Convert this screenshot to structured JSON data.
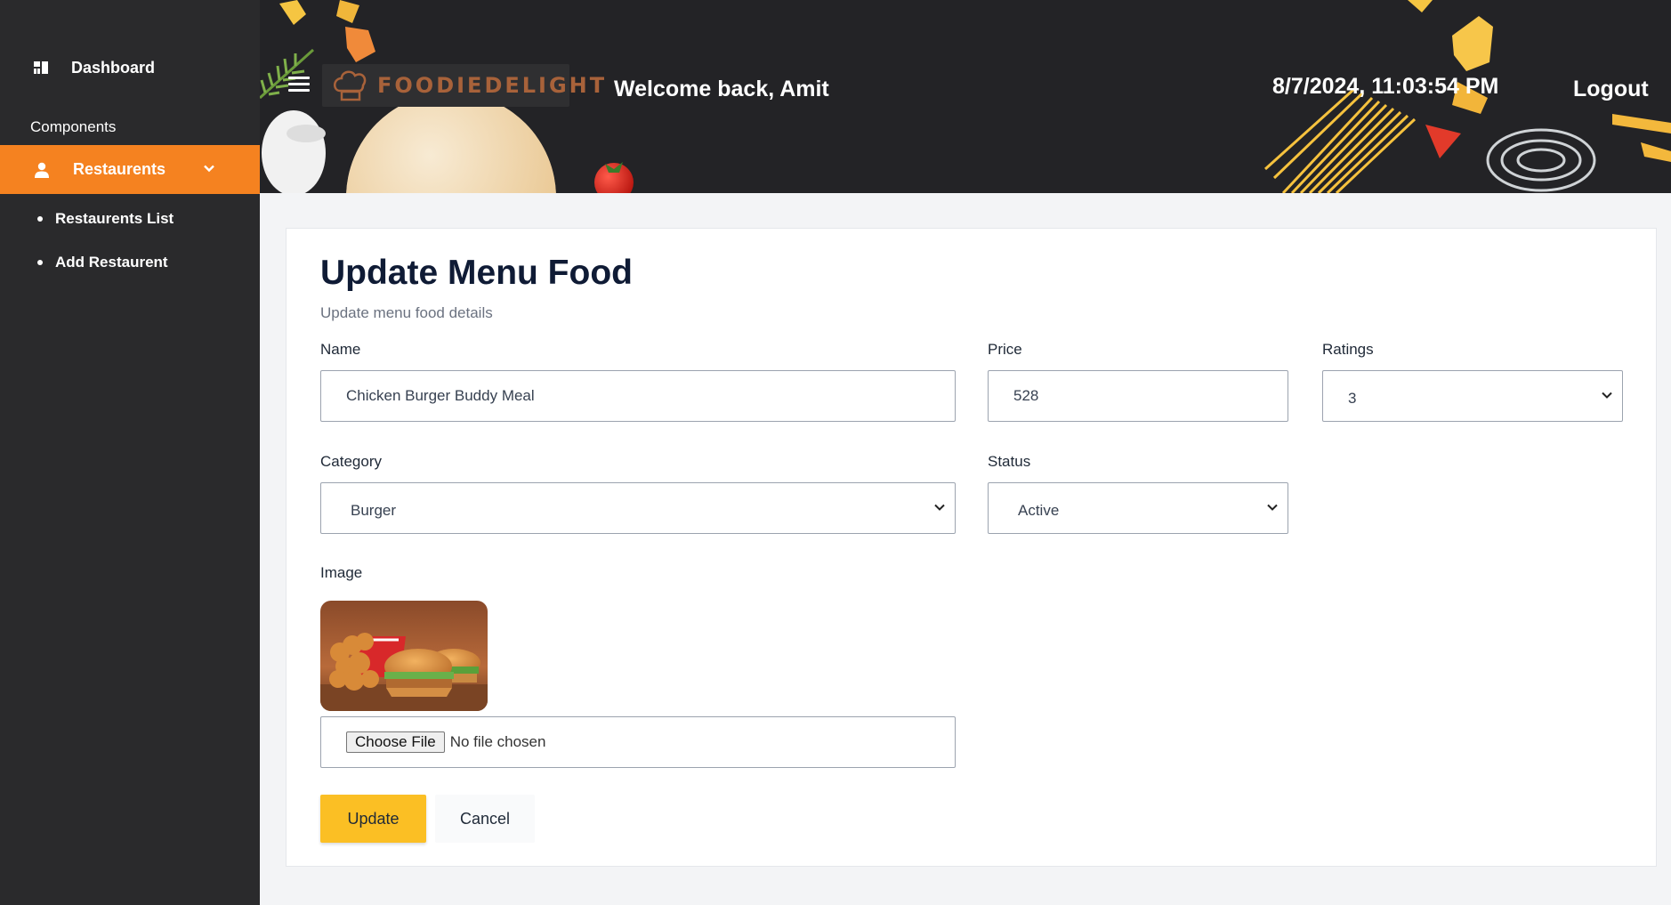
{
  "sidebar": {
    "dashboard_label": "Dashboard",
    "section_label": "Components",
    "restaurants_label": "Restaurents",
    "sub_items": [
      {
        "label": "Restaurents List"
      },
      {
        "label": "Add Restaurent"
      }
    ]
  },
  "header": {
    "logo_text": "FOODIEDELIGHT",
    "welcome": "Welcome back, Amit",
    "datetime": "8/7/2024, 11:03:54 PM",
    "logout_label": "Logout"
  },
  "form": {
    "title": "Update Menu Food",
    "subtitle": "Update menu food details",
    "name_label": "Name",
    "name_value": "Chicken Burger Buddy Meal",
    "price_label": "Price",
    "price_value": "528",
    "ratings_label": "Ratings",
    "ratings_value": "3",
    "category_label": "Category",
    "category_value": "Burger",
    "status_label": "Status",
    "status_value": "Active",
    "image_label": "Image",
    "choose_file_label": "Choose File",
    "no_file_text": "No file chosen",
    "update_label": "Update",
    "cancel_label": "Cancel"
  },
  "colors": {
    "accent_orange": "#f58220",
    "update_button": "#fbbf24",
    "sidebar_bg": "#2a2a2c",
    "header_bg": "#232326"
  }
}
